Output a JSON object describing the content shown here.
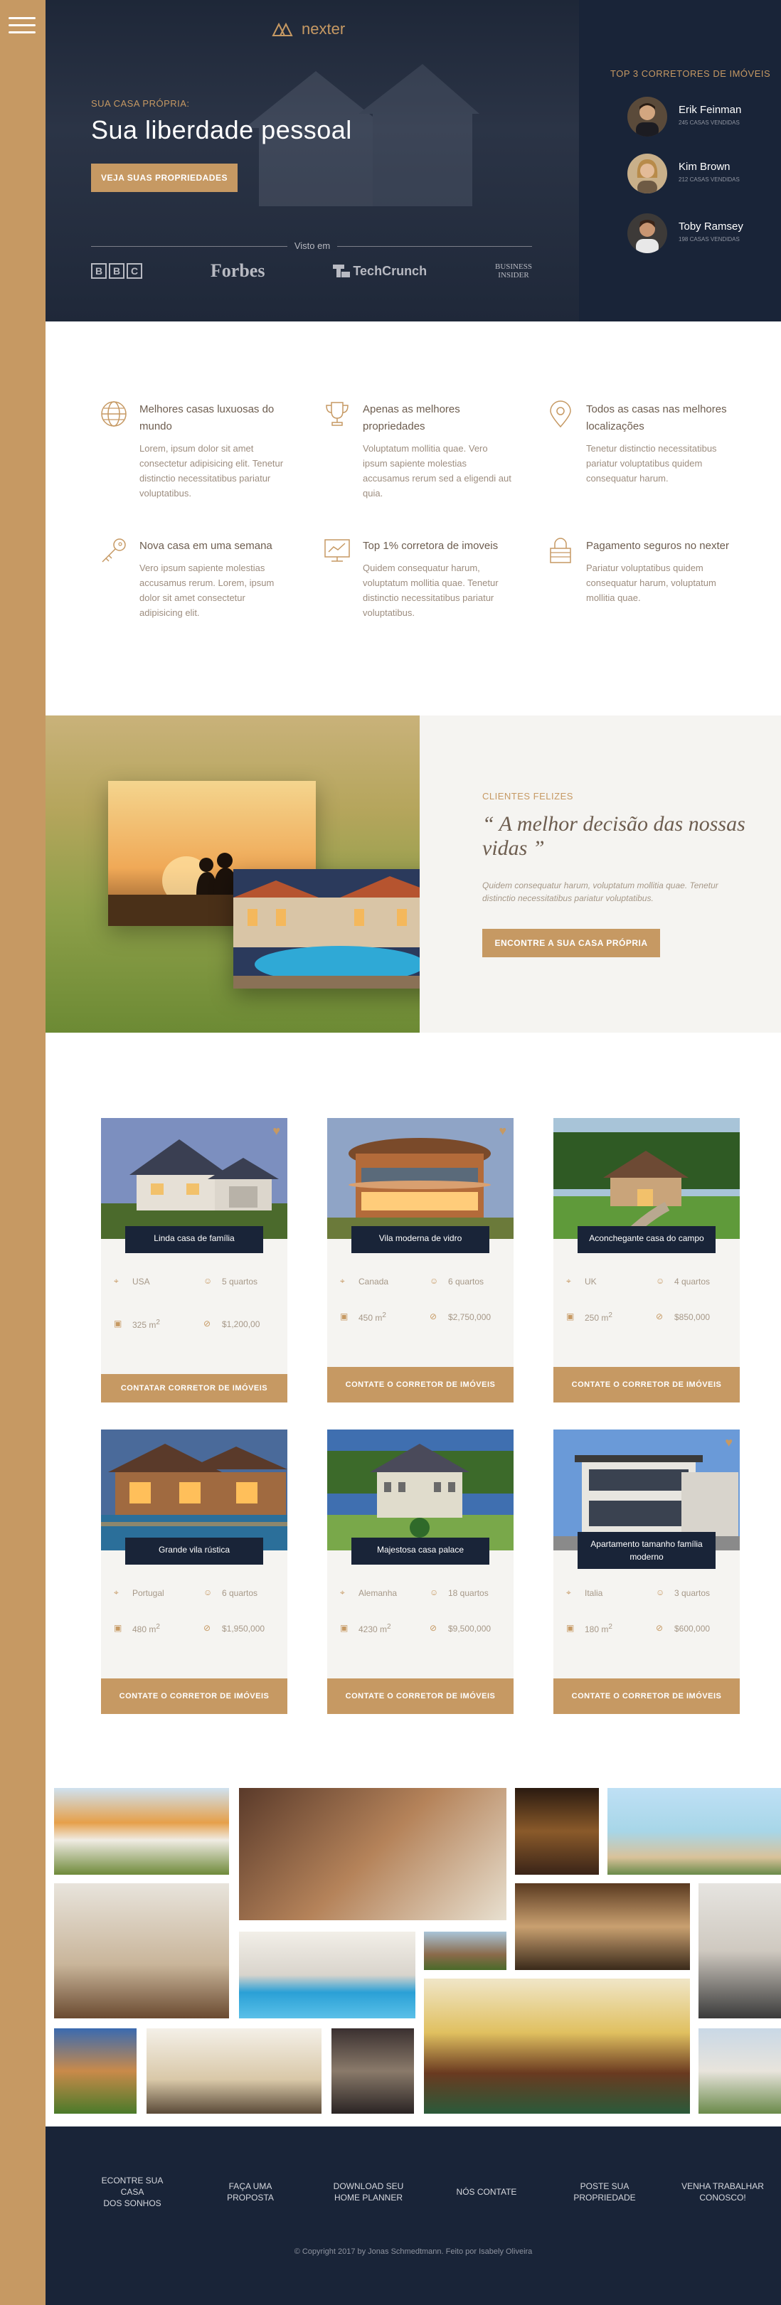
{
  "menu": {
    "icon": "hamburger-icon"
  },
  "hero": {
    "logo_text": "nexter",
    "subtitle": "SUA CASA PRÓPRIA:",
    "title": "Sua liberdade pessoal",
    "cta_label": "VEJA SUAS PROPRIEDADES",
    "seen_on_label": "Visto em",
    "brands": [
      {
        "name": "BBC"
      },
      {
        "name": "Forbes"
      },
      {
        "name": "TechCrunch"
      },
      {
        "line1": "BUSINESS",
        "line2": "INSIDER"
      }
    ]
  },
  "realtors": {
    "heading": "TOP 3 CORRETORES DE IMÓVEIS",
    "items": [
      {
        "name": "Erik Feinman",
        "sold": "245 CASAS VENDIDAS"
      },
      {
        "name": "Kim Brown",
        "sold": "212 CASAS VENDIDAS"
      },
      {
        "name": "Toby Ramsey",
        "sold": "198 CASAS VENDIDAS"
      }
    ]
  },
  "features": [
    {
      "icon": "globe-icon",
      "title": "Melhores casas luxuosas do mundo",
      "text": "Lorem, ipsum dolor sit amet consectetur adipisicing elit. Tenetur distinctio necessitatibus pariatur voluptatibus."
    },
    {
      "icon": "trophy-icon",
      "title": "Apenas as melhores propriedades",
      "text": "Voluptatum mollitia quae. Vero ipsum sapiente molestias accusamus rerum sed a eligendi aut quia."
    },
    {
      "icon": "map-pin-icon",
      "title": "Todos as casas nas melhores localizações",
      "text": "Tenetur distinctio necessitatibus pariatur voluptatibus quidem consequatur harum."
    },
    {
      "icon": "key-icon",
      "title": "Nova casa em uma semana",
      "text": "Vero ipsum sapiente molestias accusamus rerum. Lorem, ipsum dolor sit amet consectetur adipisicing elit."
    },
    {
      "icon": "chart-icon",
      "title": "Top 1% corretora de imoveis",
      "text": "Quidem consequatur harum, voluptatum mollitia quae. Tenetur distinctio necessitatibus pariatur voluptatibus."
    },
    {
      "icon": "lock-icon",
      "title": "Pagamento seguros no nexter",
      "text": "Pariatur voluptatibus quidem consequatur harum, voluptatum mollitia quae."
    }
  ],
  "story": {
    "eyebrow": "CLIENTES FELIZES",
    "quote": "“ A melhor decisão das nossas vidas ”",
    "text": "Quidem consequatur harum, voluptatum mollitia quae. Tenetur distinctio necessitatibus pariatur voluptatibus.",
    "cta_label": "ENCONTRE A SUA CASA PRÓPRIA"
  },
  "homes": [
    {
      "name": "Linda casa de família",
      "location": "USA",
      "rooms": "5 quartos",
      "area": "325 m",
      "area_sup": "2",
      "price": "$1,200,00",
      "button": "CONTATAR CORRETOR DE IMÓVEIS",
      "favorite": true
    },
    {
      "name": "Vila moderna de vidro",
      "location": "Canada",
      "rooms": "6 quartos",
      "area": "450 m",
      "area_sup": "2",
      "price": "$2,750,000",
      "button": "CONTATE O CORRETOR DE IMÓVEIS",
      "favorite": true
    },
    {
      "name": "Aconchegante casa do campo",
      "location": "UK",
      "rooms": "4 quartos",
      "area": "250 m",
      "area_sup": "2",
      "price": "$850,000",
      "button": "CONTATE O CORRETOR DE IMÓVEIS",
      "favorite": false
    },
    {
      "name": "Grande vila rústica",
      "location": "Portugal",
      "rooms": "6 quartos",
      "area": "480 m",
      "area_sup": "2",
      "price": "$1,950,000",
      "button": "CONTATE O CORRETOR DE IMÓVEIS",
      "favorite": false
    },
    {
      "name": "Majestosa casa palace",
      "location": "Alemanha",
      "rooms": "18 quartos",
      "area": "4230 m",
      "area_sup": "2",
      "price": "$9,500,000",
      "button": "CONTATE O CORRETOR DE IMÓVEIS",
      "favorite": false
    },
    {
      "name": "Apartamento tamanho família moderno",
      "location": "Italia",
      "rooms": "3 quartos",
      "area": "180 m",
      "area_sup": "2",
      "price": "$600,000",
      "button": "CONTATE O CORRETOR DE IMÓVEIS",
      "favorite": true
    }
  ],
  "footer": {
    "links": [
      {
        "line1": "ECONTRE SUA CASA",
        "line2": "DOS SONHOS"
      },
      {
        "line1": "FAÇA UMA",
        "line2": "PROPOSTA"
      },
      {
        "line1": "DOWNLOAD SEU",
        "line2": "HOME PLANNER"
      },
      {
        "line1": "NÓS CONTATE",
        "line2": ""
      },
      {
        "line1": "POSTE SUA",
        "line2": "PROPRIEDADE"
      },
      {
        "line1": "VENHA TRABALHAR",
        "line2": "CONOSCO!"
      }
    ],
    "copyright": "© Copyright 2017 by Jonas Schmedtmann. Feito por Isabely Oliveira"
  },
  "colors": {
    "gold": "#c69963",
    "navy": "#192438",
    "cream": "#f5f4f1",
    "text": "#6d5d4f"
  }
}
